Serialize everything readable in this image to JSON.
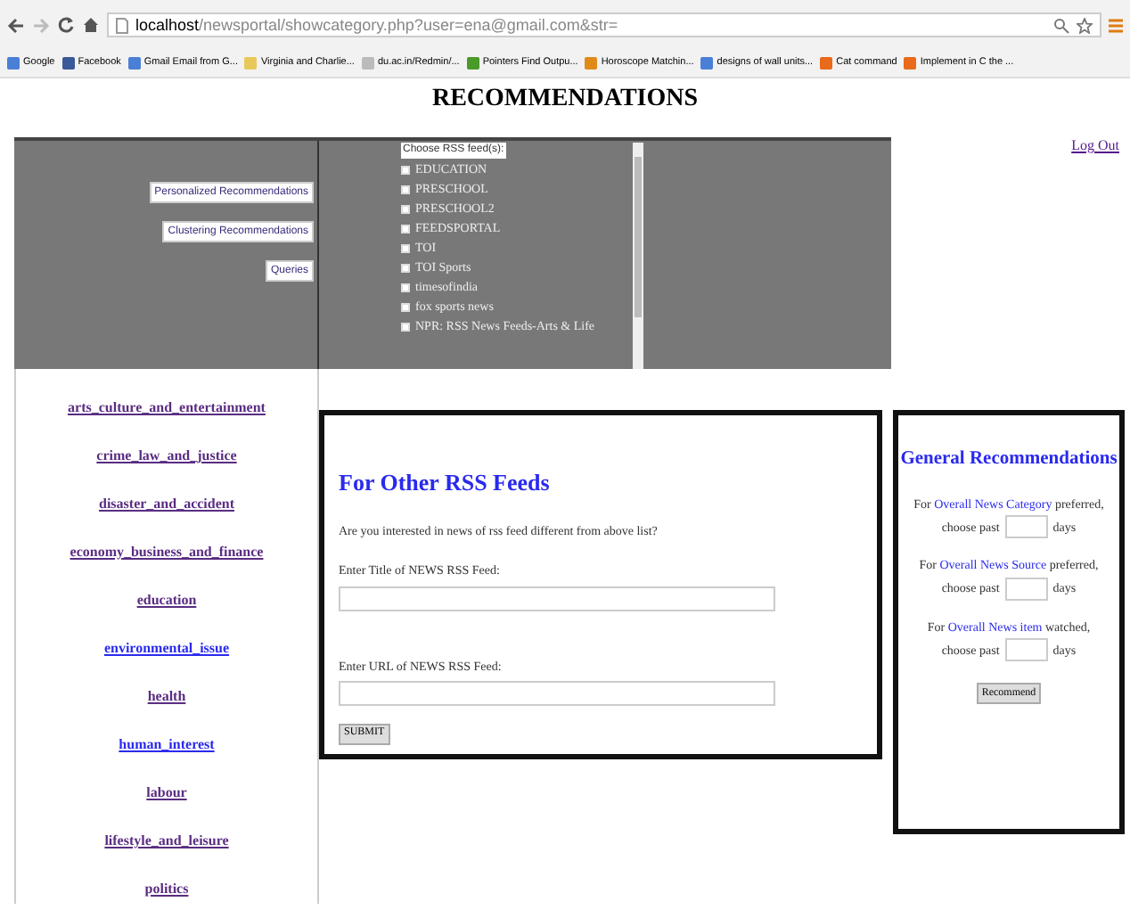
{
  "browser": {
    "url_host": "localhost",
    "url_path": "/newsportal/showcategory.php?user=ena@gmail.com&str=",
    "bookmarks": [
      {
        "label": "Google",
        "color": "#4a7fd6"
      },
      {
        "label": "Facebook",
        "color": "#3b5998"
      },
      {
        "label": "Gmail Email from G...",
        "color": "#4a7fd6"
      },
      {
        "label": "Virginia and Charlie...",
        "color": "#e8c85a"
      },
      {
        "label": "du.ac.in/Redmin/...",
        "color": "#bbbbbb"
      },
      {
        "label": "Pointers Find Outpu...",
        "color": "#4a9a2a"
      },
      {
        "label": "Horoscope Matchin...",
        "color": "#e08a1a"
      },
      {
        "label": "designs of wall units...",
        "color": "#4a7fd6"
      },
      {
        "label": "Cat command",
        "color": "#e86a1a"
      },
      {
        "label": "Implement in C the ...",
        "color": "#e86a1a"
      }
    ]
  },
  "page_title": "RECOMMENDATIONS",
  "logout": "Log Out",
  "menu_buttons": [
    "Personalized Recommendations",
    "Clustering Recommendations",
    "Queries"
  ],
  "feeds": {
    "header": "Choose RSS feed(s):",
    "items": [
      {
        "label": "EDUCATION",
        "checked": false
      },
      {
        "label": "PRESCHOOL",
        "checked": false
      },
      {
        "label": "PRESCHOOL2",
        "checked": false
      },
      {
        "label": "FEEDSPORTAL",
        "checked": false
      },
      {
        "label": "TOI",
        "checked": false
      },
      {
        "label": "TOI Sports",
        "checked": false
      },
      {
        "label": "timesofindia",
        "checked": false
      },
      {
        "label": "fox sports news",
        "checked": false
      },
      {
        "label": "NPR: RSS News Feeds-Arts & Life",
        "checked": false
      }
    ]
  },
  "categories": [
    {
      "label": "arts_culture_and_entertainment",
      "visited": true
    },
    {
      "label": "crime_law_and_justice",
      "visited": true
    },
    {
      "label": "disaster_and_accident",
      "visited": true
    },
    {
      "label": "economy_business_and_finance",
      "visited": true
    },
    {
      "label": "education",
      "visited": true
    },
    {
      "label": "environmental_issue",
      "visited": false
    },
    {
      "label": "health",
      "visited": true
    },
    {
      "label": "human_interest",
      "visited": false
    },
    {
      "label": "labour",
      "visited": true
    },
    {
      "label": "lifestyle_and_leisure",
      "visited": true
    },
    {
      "label": "politics",
      "visited": true
    }
  ],
  "other_feeds": {
    "heading": "For Other RSS Feeds",
    "question": "Are you interested in news of rss feed different from above list?",
    "title_label": "Enter Title of NEWS RSS Feed:",
    "url_label": "Enter URL of NEWS RSS Feed:",
    "submit": "SUBMIT"
  },
  "general": {
    "heading": "General Recommendations",
    "items": [
      {
        "prefix": "For",
        "link": "Overall News Category",
        "suffix": "preferred,",
        "choose": "choose past",
        "unit": "days"
      },
      {
        "prefix": "For",
        "link": "Overall News Source",
        "suffix": "preferred,",
        "choose": "choose past",
        "unit": "days"
      },
      {
        "prefix": "For",
        "link": "Overall News item",
        "suffix": "watched,",
        "choose": "choose past",
        "unit": "days"
      }
    ],
    "button": "Recommend"
  }
}
